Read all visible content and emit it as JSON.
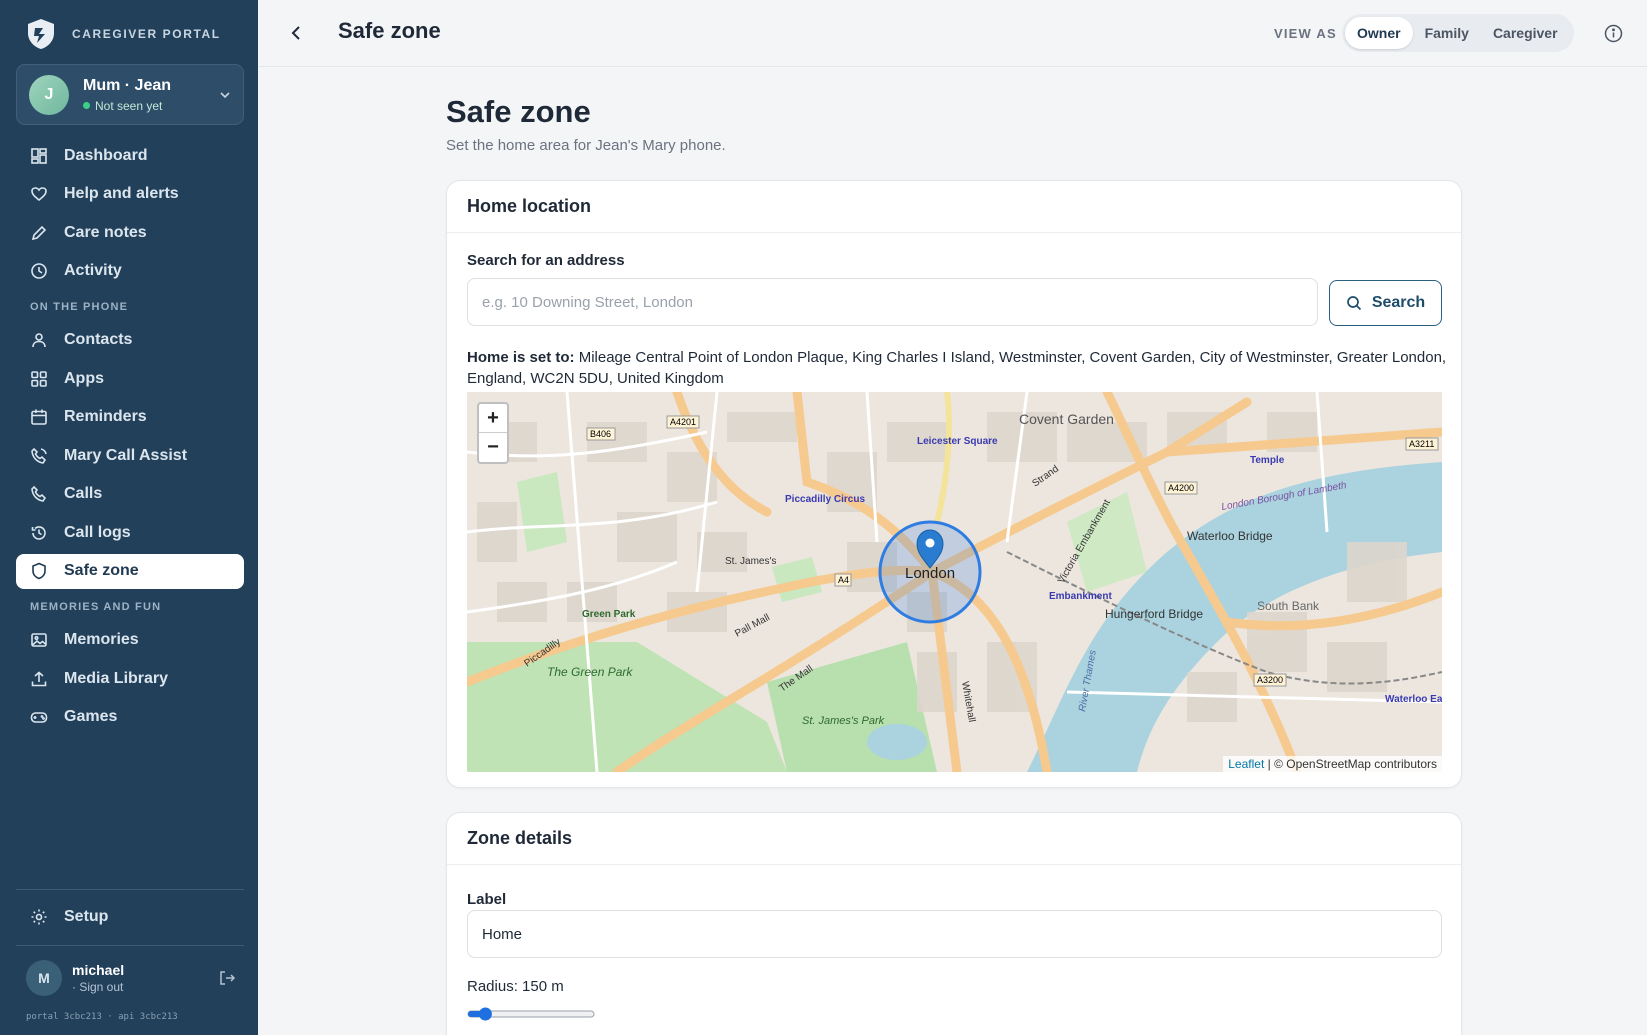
{
  "sidebar": {
    "brand": "CAREGIVER PORTAL",
    "profile": {
      "initial": "J",
      "name": "Mum · Jean",
      "status": "Not seen yet"
    },
    "items_main": [
      {
        "label": "Dashboard",
        "icon": "dashboard-icon"
      },
      {
        "label": "Help and alerts",
        "icon": "heart-icon"
      },
      {
        "label": "Care notes",
        "icon": "pencil-icon"
      },
      {
        "label": "Activity",
        "icon": "clock-icon"
      }
    ],
    "section_phone": "ON THE PHONE",
    "items_phone": [
      {
        "label": "Contacts",
        "icon": "person-icon"
      },
      {
        "label": "Apps",
        "icon": "apps-grid-icon"
      },
      {
        "label": "Reminders",
        "icon": "calendar-icon"
      },
      {
        "label": "Mary Call Assist",
        "icon": "phone-assist-icon"
      },
      {
        "label": "Calls",
        "icon": "phone-icon"
      },
      {
        "label": "Call logs",
        "icon": "history-icon"
      },
      {
        "label": "Safe zone",
        "icon": "shield-icon",
        "active": true
      }
    ],
    "section_memories": "MEMORIES AND FUN",
    "items_memories": [
      {
        "label": "Memories",
        "icon": "image-icon"
      },
      {
        "label": "Media Library",
        "icon": "upload-icon"
      },
      {
        "label": "Games",
        "icon": "gamepad-icon"
      }
    ],
    "setup": "Setup",
    "user": {
      "initial": "M",
      "name": "michael",
      "sign_out": "· Sign out"
    },
    "version": "portal 3cbc213 · api 3cbc213"
  },
  "topbar": {
    "title": "Safe zone",
    "view_as": "VIEW AS",
    "roles": [
      "Owner",
      "Family",
      "Caregiver"
    ],
    "selected_role": "Owner"
  },
  "main": {
    "title": "Safe zone",
    "subtitle": "Set the home area for Jean's Mary phone.",
    "home_card": {
      "heading": "Home location",
      "search_label": "Search for an address",
      "search_placeholder": "e.g. 10 Downing Street, London",
      "search_button": "Search",
      "home_prefix": "Home is set to:",
      "home_address": "Mileage Central Point of London Plaque, King Charles I Island, Westminster, Covent Garden, City of Westminster, Greater London, England, WC2N 5DU, United Kingdom"
    },
    "map": {
      "zoom_in": "+",
      "zoom_out": "−",
      "attribution_leaflet": "Leaflet",
      "attribution_rest": "| © OpenStreetMap contributors",
      "labels": {
        "covent_garden": "Covent Garden",
        "london": "London",
        "piccadilly_circus": "Piccadilly Circus",
        "leicester_square": "Leicester Square",
        "waterloo_bridge": "Waterloo Bridge",
        "south_bank": "South Bank",
        "hungerford_bridge": "Hungerford Bridge",
        "st_jamess_park": "St. James's Park",
        "green_park": "Green Park",
        "the_green_park": "The Green Park",
        "temple": "Temple",
        "waterloo_east": "Waterloo East",
        "strand": "Strand",
        "pall_mall": "Pall Mall",
        "the_mall": "The Mall",
        "whitehall": "Whitehall",
        "embankment": "Embankment",
        "victoria_embankment": "Victoria Embankment",
        "st_jamess": "St. James's",
        "piccadilly": "Piccadilly",
        "river_thames": "River Thames",
        "a4": "A4",
        "a4200": "A4200",
        "a3211": "A3211",
        "a3200": "A3200",
        "a4201": "A4201",
        "b406": "B406",
        "london_borough_lambeth": "London Borough of Lambeth"
      }
    },
    "zone_card": {
      "heading": "Zone details",
      "label_label": "Label",
      "label_value": "Home",
      "radius_text": "Radius: 150 m",
      "radius_m": 150,
      "radius_slider_fraction": 0.1
    }
  },
  "colors": {
    "sidebar_bg": "#22405a",
    "accent": "#2b5f80",
    "zone_circle": "#2f7de0"
  }
}
